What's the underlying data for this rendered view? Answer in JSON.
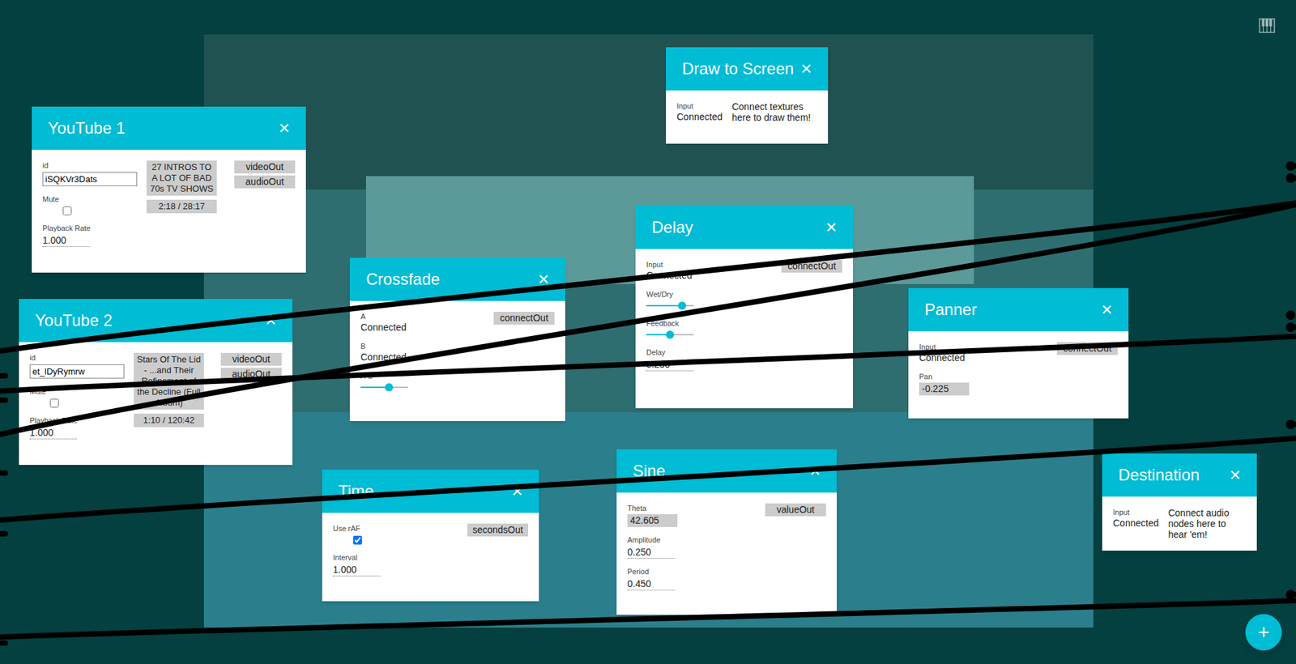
{
  "nodes": [
    {
      "title": "YouTube 1",
      "close": "×",
      "rows": [
        {
          "kind": "field",
          "label": "id",
          "value": "iSQKVr3Dats"
        },
        {
          "kind": "checkbox",
          "label": "Mute",
          "checked": false
        },
        {
          "kind": "number",
          "label": "Playback Rate",
          "value": "1.000"
        }
      ],
      "info": [
        "27 INTROS TO A LOT OF BAD 70s TV SHOWS",
        "2:18 / 28:17"
      ],
      "outputs": [
        {
          "label": "videoOut",
          "connected": true
        },
        {
          "label": "audioOut",
          "connected": true
        }
      ]
    },
    {
      "title": "YouTube 2",
      "close": "×",
      "rows": [
        {
          "kind": "field",
          "label": "id",
          "value": "et_lDyRymrw"
        },
        {
          "kind": "checkbox",
          "label": "Mute",
          "checked": false
        },
        {
          "kind": "number",
          "label": "Playback Rate",
          "value": "1.000"
        }
      ],
      "info": [
        "Stars Of The Lid - ...and Their Refinement of the Decline (Full Album)",
        "1:10 / 120:42"
      ],
      "outputs": [
        {
          "label": "videoOut",
          "connected": true
        },
        {
          "label": "audioOut",
          "connected": true
        }
      ]
    },
    {
      "title": "Crossfade",
      "close": "×",
      "rows": [
        {
          "kind": "input",
          "label": "A",
          "value": "Connected"
        },
        {
          "kind": "input",
          "label": "B",
          "value": "Connected"
        },
        {
          "kind": "slider",
          "label": "A-B",
          "level": 0.6
        }
      ],
      "outputs": [
        {
          "label": "connectOut",
          "connected": true
        }
      ]
    },
    {
      "title": "Draw to Screen",
      "close": "×",
      "rows": [
        {
          "kind": "input",
          "label": "Input",
          "value": "Connected"
        }
      ],
      "note": "Connect textures here to draw them!",
      "outputs": []
    },
    {
      "title": "Delay",
      "close": "×",
      "rows": [
        {
          "kind": "input",
          "label": "Input",
          "value": "Connected"
        },
        {
          "kind": "slider",
          "label": "Wet/Dry",
          "level": 0.75
        },
        {
          "kind": "slider",
          "label": "Feedback",
          "level": 0.5
        },
        {
          "kind": "number",
          "label": "Delay",
          "value": "0.250"
        }
      ],
      "outputs": [
        {
          "label": "connectOut",
          "connected": true
        }
      ]
    },
    {
      "title": "Panner",
      "close": "×",
      "rows": [
        {
          "kind": "input",
          "label": "Input",
          "value": "Connected"
        },
        {
          "kind": "boxed",
          "label": "Pan",
          "value": "-0.225"
        }
      ],
      "outputs": [
        {
          "label": "connectOut",
          "connected": true
        }
      ]
    },
    {
      "title": "Destination",
      "close": "×",
      "rows": [
        {
          "kind": "input",
          "label": "Input",
          "value": "Connected"
        }
      ],
      "note": "Connect audio nodes here to hear 'em!",
      "outputs": []
    },
    {
      "title": "Time",
      "close": "×",
      "rows": [
        {
          "kind": "checkbox",
          "label": "Use rAF",
          "checked": true
        },
        {
          "kind": "number",
          "label": "Interval",
          "value": "1.000"
        }
      ],
      "outputs": [
        {
          "label": "secondsOut",
          "connected": true
        }
      ]
    },
    {
      "title": "Sine",
      "close": "×",
      "rows": [
        {
          "kind": "boxed",
          "label": "Theta",
          "value": "42.605"
        },
        {
          "kind": "number",
          "label": "Amplitude",
          "value": "0.250"
        },
        {
          "kind": "number",
          "label": "Period",
          "value": "0.450"
        }
      ],
      "outputs": [
        {
          "label": "valueOut",
          "connected": true
        }
      ]
    }
  ],
  "connections": [
    {
      "from": {
        "node": 0,
        "output": 0
      },
      "to": {
        "node": 3,
        "row": 0
      }
    },
    {
      "from": {
        "node": 0,
        "output": 1
      },
      "to": {
        "node": 2,
        "row": 0
      }
    },
    {
      "from": {
        "node": 1,
        "output": 1
      },
      "to": {
        "node": 2,
        "row": 1
      }
    },
    {
      "from": {
        "node": 2,
        "output": 0
      },
      "to": {
        "node": 4,
        "row": 0
      }
    },
    {
      "from": {
        "node": 4,
        "output": 0
      },
      "to": {
        "node": 5,
        "row": 0
      }
    },
    {
      "from": {
        "node": 5,
        "output": 0
      },
      "to": {
        "node": 6,
        "row": 0
      }
    },
    {
      "from": {
        "node": 7,
        "output": 0
      },
      "to": {
        "node": 8,
        "row": 0
      }
    },
    {
      "from": {
        "node": 8,
        "output": 0
      },
      "to": {
        "node": 5,
        "row": 1
      }
    }
  ],
  "add_button": "+"
}
